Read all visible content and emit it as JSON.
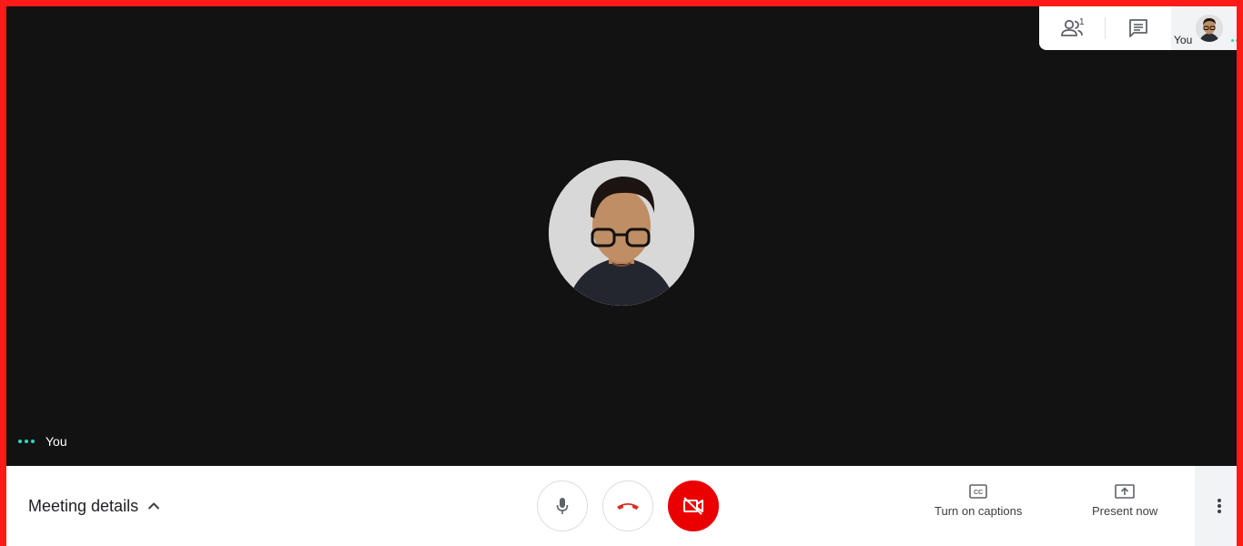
{
  "main": {
    "self_label": "You"
  },
  "top_panel": {
    "participants_count": "1",
    "self_label": "You"
  },
  "bottom": {
    "meeting_details": "Meeting details",
    "captions_label": "Turn on captions",
    "present_label": "Present now"
  },
  "colors": {
    "frame": "#ff1a1a",
    "stage": "#121212",
    "camera_off": "#ea0000",
    "hangup_icon": "#d93025",
    "speaking_dots": "#35d4c0"
  },
  "icons": {
    "participants": "people-icon",
    "chat": "chat-icon",
    "mic": "microphone-icon",
    "hangup": "phone-hangup-icon",
    "camera": "camera-off-icon",
    "captions": "closed-captions-icon",
    "present": "present-screen-icon",
    "more": "more-vert-icon",
    "details": "chevron-up-icon"
  }
}
